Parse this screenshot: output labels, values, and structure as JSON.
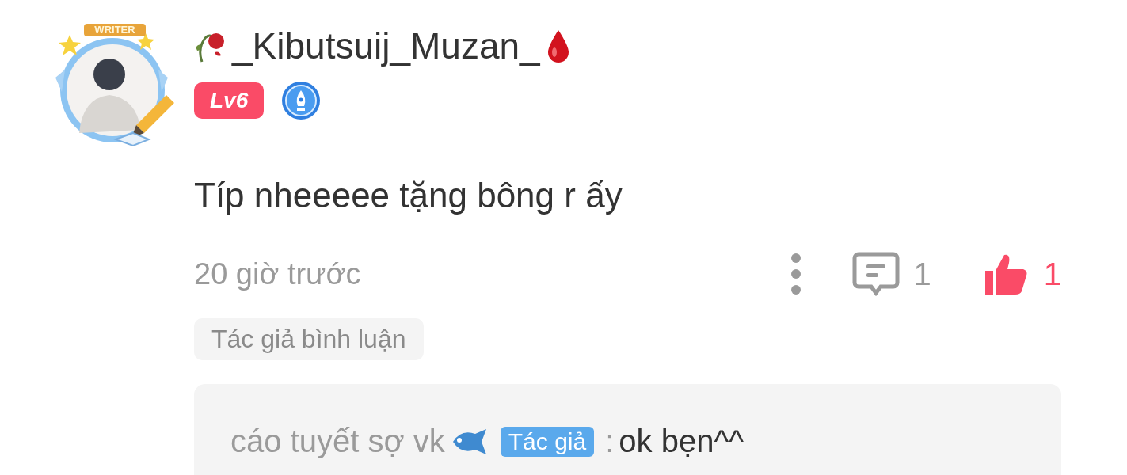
{
  "comment": {
    "avatar": {
      "frame_label": "WRITER"
    },
    "author": {
      "name": "_Kibutsuij_Muzan_",
      "level": "Lv6"
    },
    "text": "Típ nheeeee tặng bông r ấy",
    "time": "20 giờ trước",
    "replies_count": "1",
    "likes_count": "1",
    "liked": true,
    "tag": "Tác giả bình luận",
    "replies": [
      {
        "author": "cáo tuyết sợ vk",
        "badge": "Tác giả",
        "separator": ":",
        "text": "ok bẹn^^"
      }
    ]
  }
}
